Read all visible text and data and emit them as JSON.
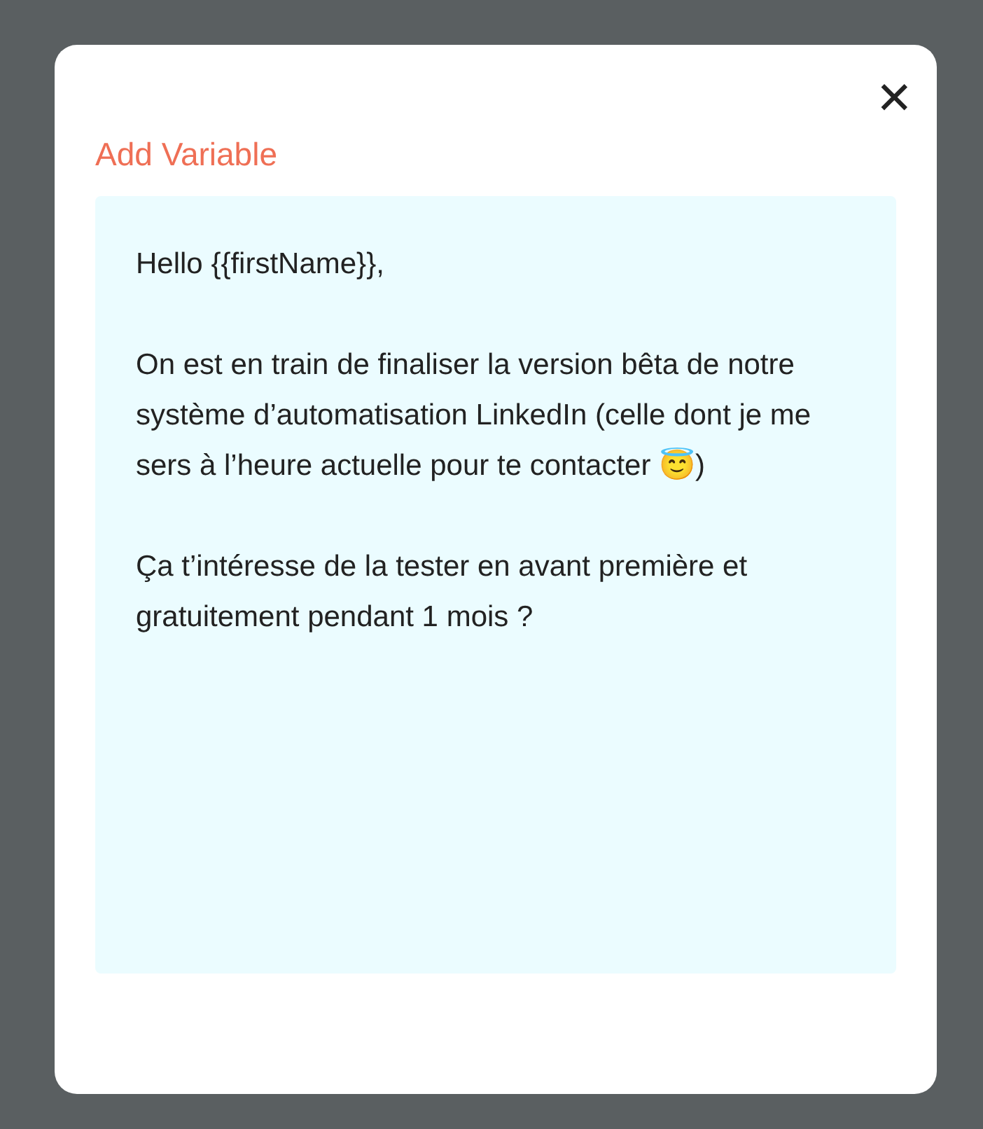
{
  "dialog": {
    "close_label": "✕",
    "add_variable_link": "Add Variable",
    "message": "Hello {{firstName}},\n\nOn est en train de finaliser la version bêta de notre système d’automatisation LinkedIn (celle dont je me sers à l’heure actuelle pour te contacter 😇)\n\nÇa t’intéresse de la tester en avant première et gratuitement pendant 1 mois ?"
  }
}
